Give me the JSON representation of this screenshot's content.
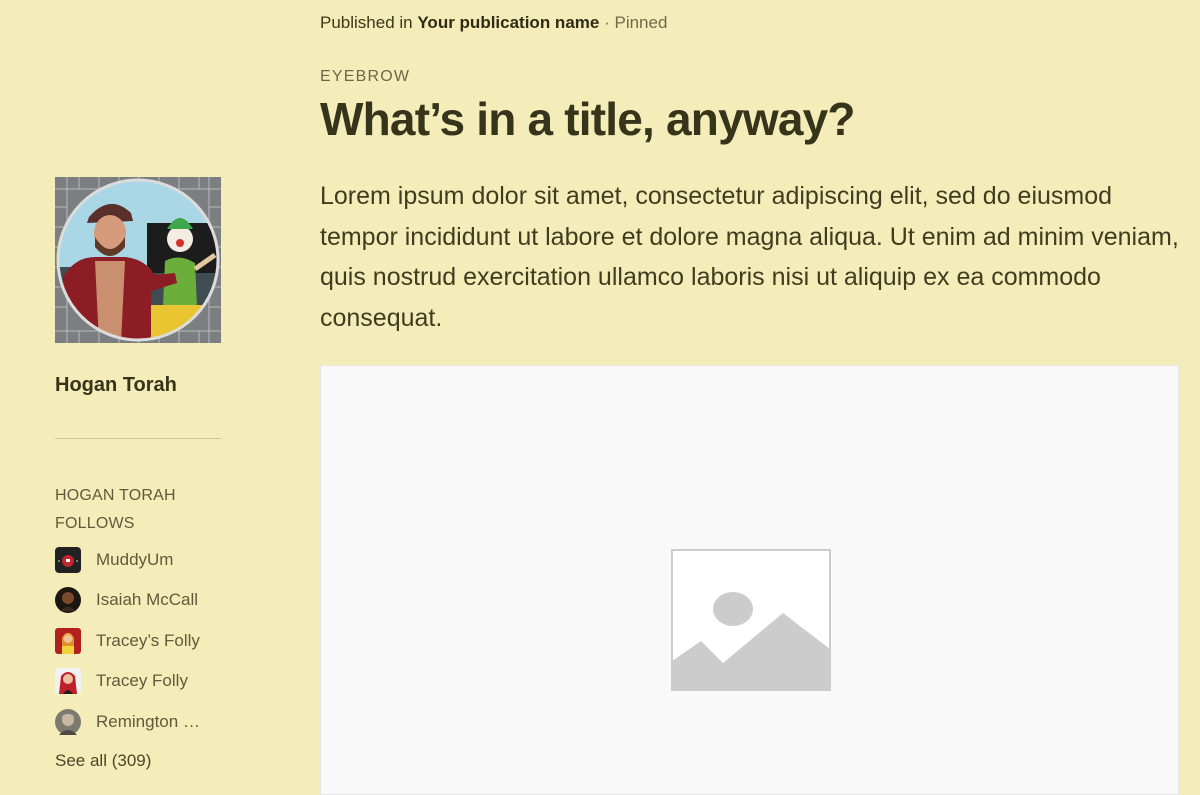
{
  "sidebar": {
    "author_name": "Hogan Torah",
    "follows_heading": "HOGAN TORAH FOLLOWS",
    "follows": [
      {
        "name": "MuddyUm",
        "avatar": "muddyum-avatar"
      },
      {
        "name": "Isaiah McCall",
        "avatar": "isaiah-mccall-avatar"
      },
      {
        "name": "Tracey’s Folly",
        "avatar": "traceys-folly-avatar"
      },
      {
        "name": "Tracey Folly",
        "avatar": "tracey-folly-avatar"
      },
      {
        "name": "Remington W...",
        "avatar": "remington-avatar"
      }
    ],
    "see_all": "See all (309)"
  },
  "header": {
    "published_prefix": "Published in",
    "publication_name": "Your publication name",
    "separator": "·",
    "status": "Pinned"
  },
  "article": {
    "eyebrow": "EYEBROW",
    "title": "What’s in a title, anyway?",
    "lead": "Lorem ipsum dolor sit amet, consectetur adipiscing elit, sed do eiusmod tempor incididunt ut labore et dolore magna aliqua. Ut enim ad minim veniam, quis nostrud exercitation ullamco laboris nisi ut aliquip ex ea commodo consequat.",
    "image_icon": "image-placeholder-icon"
  },
  "colors": {
    "page_background": "#f4edb9",
    "text_primary": "#36341a",
    "text_muted": "#5e5b3c",
    "image_background": "#f9f9f9",
    "placeholder_gray": "#cccccc"
  }
}
